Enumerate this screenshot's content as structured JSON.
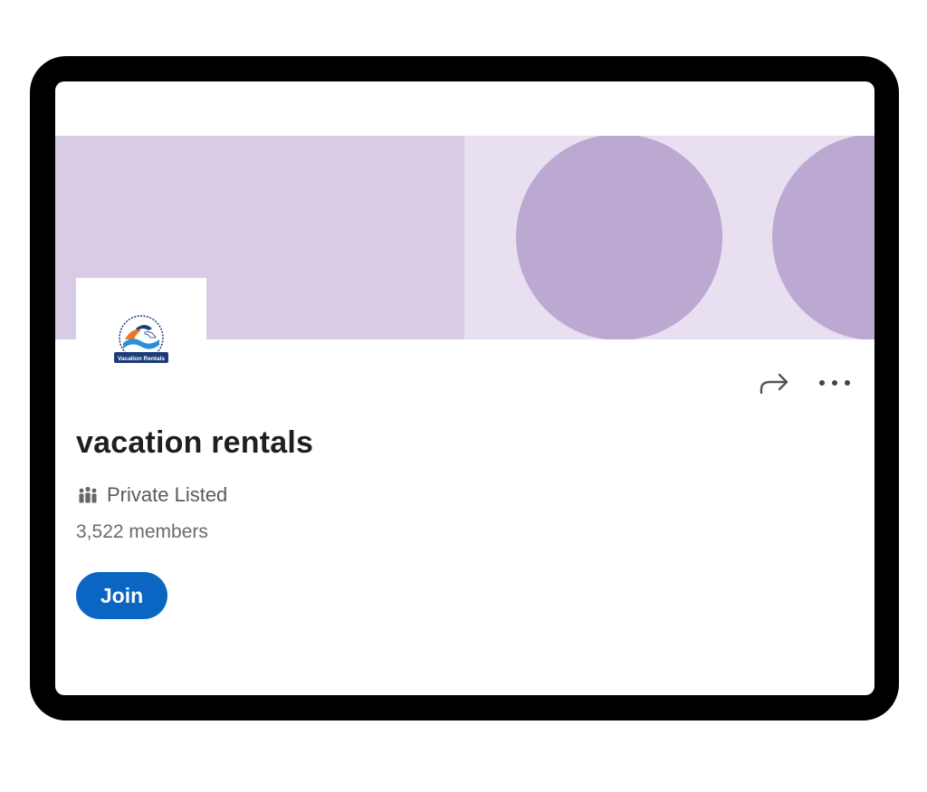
{
  "group": {
    "name": "vacation rentals",
    "privacy": "Private Listed",
    "members": "3,522 members",
    "join_label": "Join"
  },
  "logo": {
    "text": "Vacation Rentals"
  },
  "icons": {
    "share": "share-arrow-icon",
    "more": "more-options-icon",
    "privacy": "group-people-icon"
  },
  "colors": {
    "primary_button": "#0a66c2",
    "cover_left": "#d8cbe6",
    "cover_right": "#e8dff1",
    "cover_circles": "#bba9d2"
  }
}
